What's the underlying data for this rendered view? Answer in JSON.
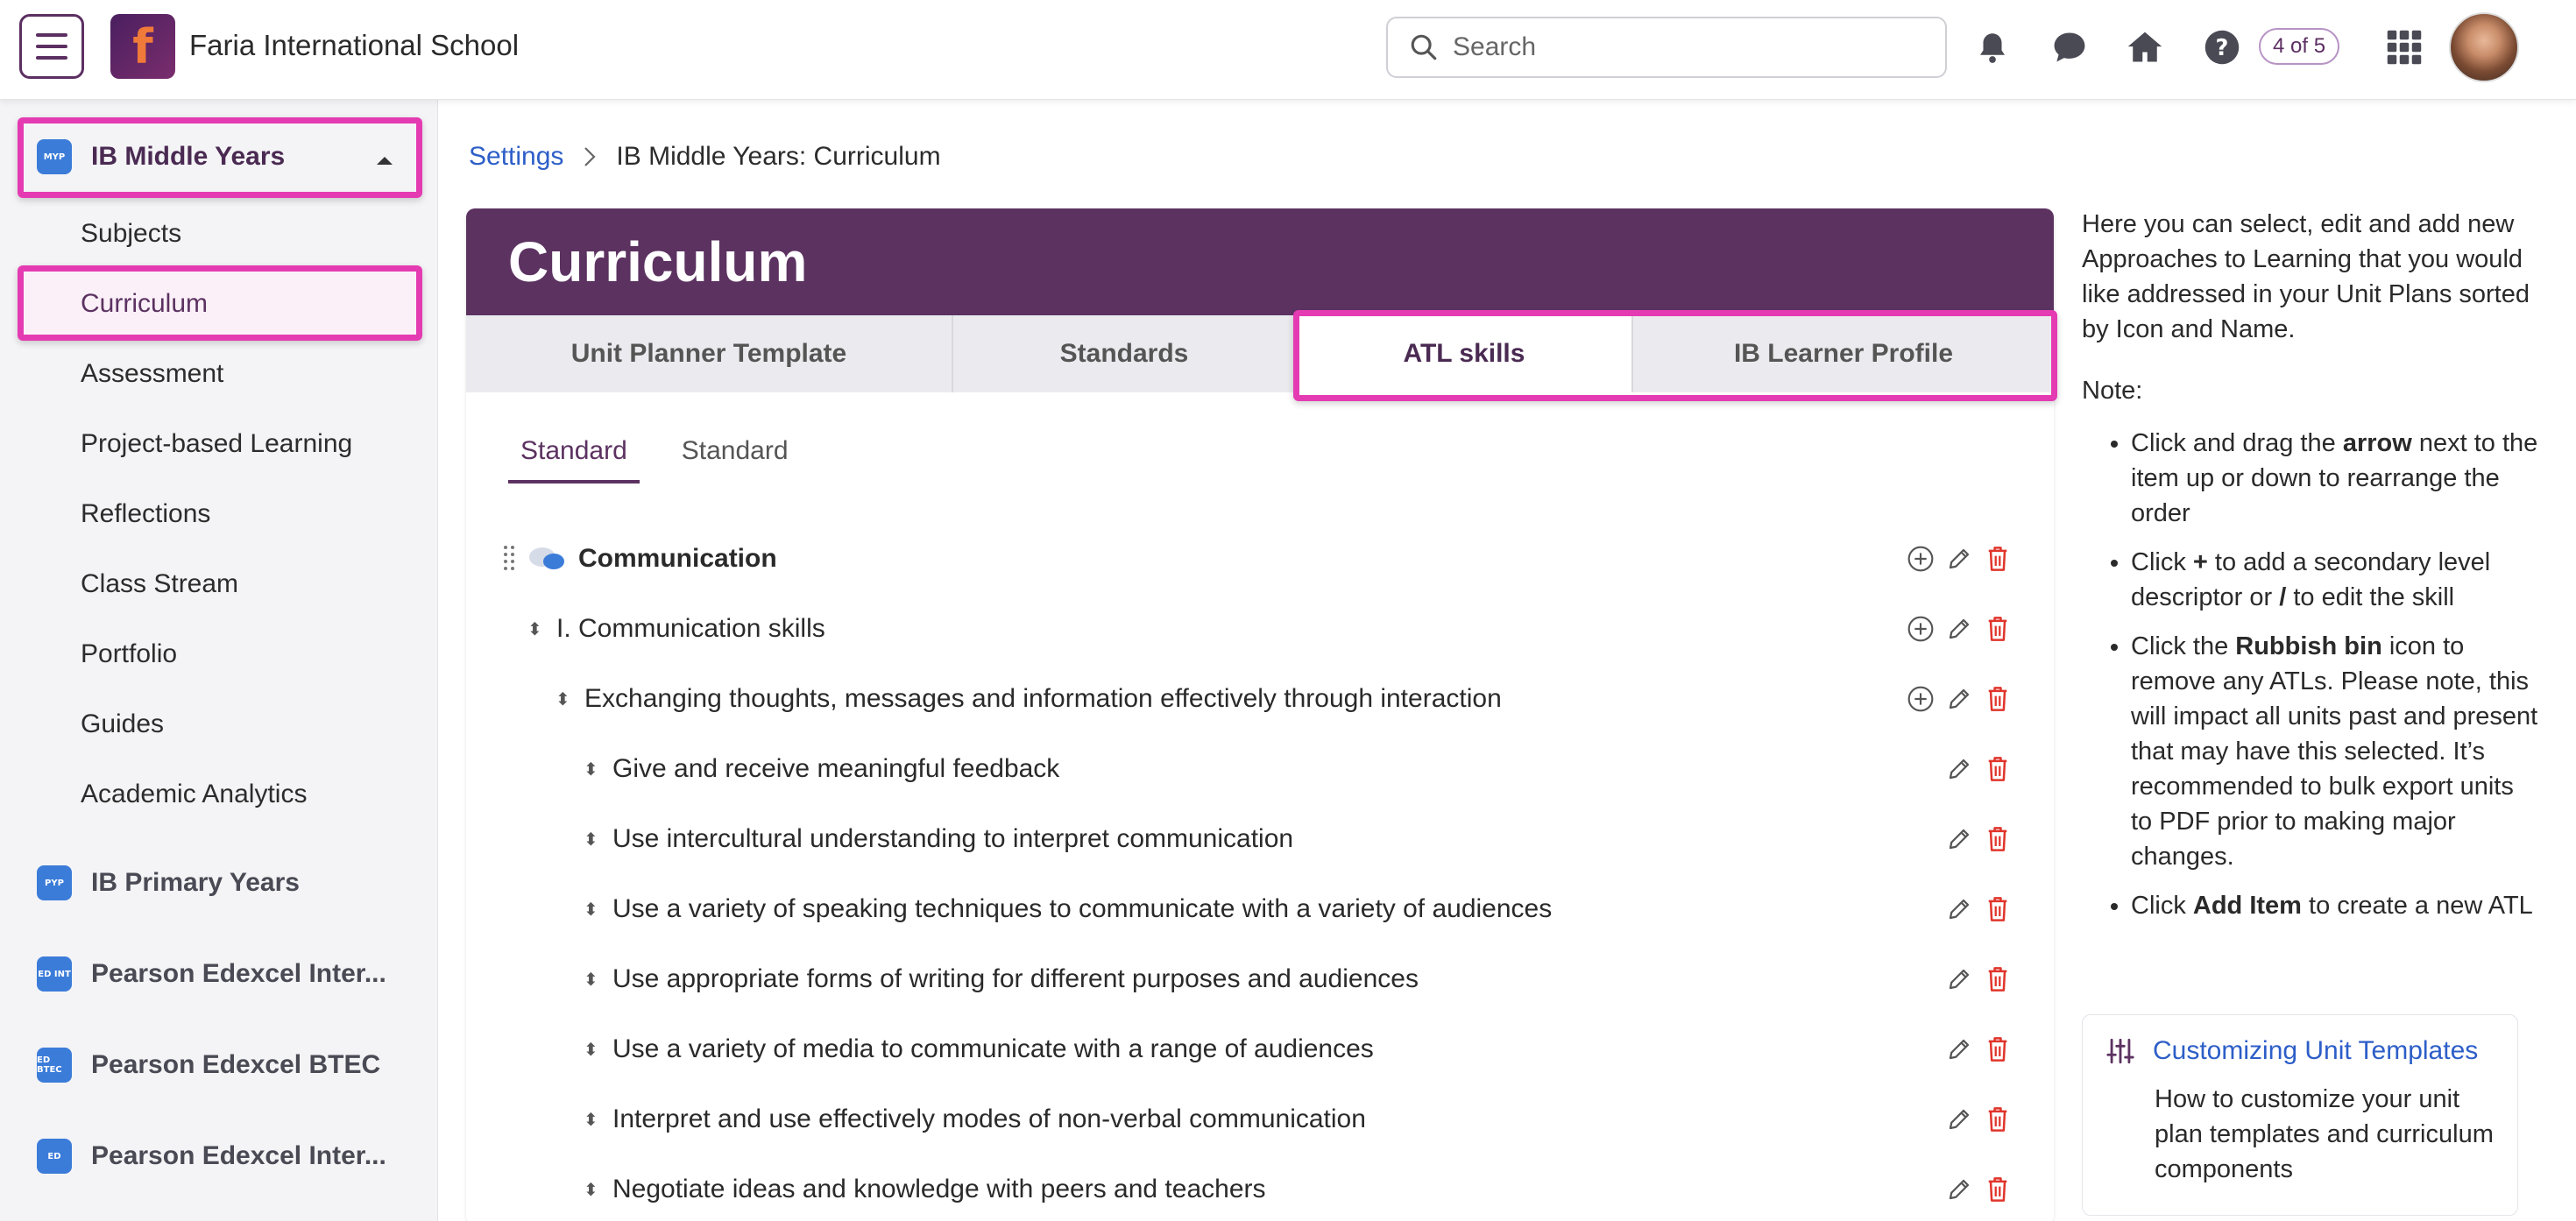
{
  "header": {
    "school_name": "Faria International School",
    "search_placeholder": "Search",
    "onboarding_count": "4 of 5"
  },
  "sidebar": {
    "active_program": "IB Middle Years",
    "items": [
      "Subjects",
      "Curriculum",
      "Assessment",
      "Project-based Learning",
      "Reflections",
      "Class Stream",
      "Portfolio",
      "Guides",
      "Academic Analytics"
    ],
    "programs": [
      "IB Primary Years",
      "Pearson Edexcel Inter...",
      "Pearson Edexcel BTEC",
      "Pearson Edexcel Inter..."
    ],
    "program_icon_labels": [
      "MYP",
      "PYP",
      "ED INT",
      "ED BTEC",
      "ED"
    ]
  },
  "breadcrumb": {
    "parent": "Settings",
    "current": "IB Middle Years: Curriculum"
  },
  "curriculum": {
    "title": "Curriculum",
    "tabs": [
      "Unit Planner Template",
      "Standards",
      "ATL skills",
      "IB Learner Profile"
    ],
    "active_tab": "ATL skills",
    "subtabs": [
      "Standard",
      "Standard"
    ],
    "rows": [
      "Communication",
      "I. Communication skills",
      "Exchanging thoughts, messages and information effectively through interaction",
      "Give and receive meaningful feedback",
      "Use intercultural understanding to interpret communication",
      "Use a variety of speaking techniques to communicate with a variety of audiences",
      "Use appropriate forms of writing for different purposes and audiences",
      "Use a variety of media to communicate with a range of audiences",
      "Interpret and use effectively modes of non-verbal communication",
      "Negotiate ideas and knowledge with peers and teachers"
    ]
  },
  "help": {
    "intro": "Here you can select, edit and add new Approaches to Learning that you would like addressed in your Unit Plans sorted by Icon and Name.",
    "note_label": "Note:",
    "b1_pre": "Click and drag the ",
    "b1_bold": "arrow",
    "b1_post": " next to the item up or down to rearrange the order",
    "b2_pre": "Click ",
    "b2_bold1": "+",
    "b2_mid": " to add a secondary level descriptor or ",
    "b2_bold2": "/",
    "b2_post": " to edit the skill",
    "b3_pre": "Click the ",
    "b3_bold": "Rubbish bin",
    "b3_post": " icon to remove any ATLs. Please note, this will impact all units past and present that may have this selected. It’s recommended to bulk export units to PDF prior to making major changes.",
    "b4_pre": "Click ",
    "b4_bold": "Add Item",
    "b4_post": " to create a new ATL",
    "kb_title": "Customizing Unit Templates",
    "kb_desc": "How to customize your unit plan templates and curriculum components"
  },
  "colors": {
    "brand_purple": "#5c3261",
    "highlight_pink": "#e43bb2",
    "link_blue": "#2d5ec8",
    "delete_red": "#e0352b"
  }
}
